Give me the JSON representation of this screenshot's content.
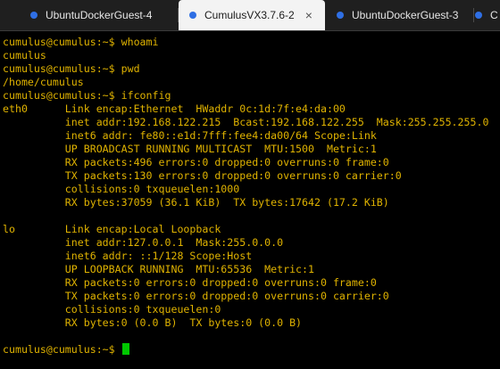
{
  "tabs": [
    {
      "label": "UbuntuDockerGuest-4",
      "active": false,
      "dot_color": "#2f6fe4"
    },
    {
      "label": "CumulusVX3.7.6-2",
      "active": true,
      "dot_color": "#2f6fe4",
      "close": "×"
    },
    {
      "label": "UbuntuDockerGuest-3",
      "active": false,
      "dot_color": "#2f6fe4"
    },
    {
      "label": "C",
      "active": false,
      "dot_color": "#2f6fe4"
    }
  ],
  "terminal": {
    "text_color": "#e0b300",
    "cursor_color": "#00c800",
    "lines": [
      "cumulus@cumulus:~$ whoami",
      "cumulus",
      "cumulus@cumulus:~$ pwd",
      "/home/cumulus",
      "cumulus@cumulus:~$ ifconfig",
      "eth0      Link encap:Ethernet  HWaddr 0c:1d:7f:e4:da:00",
      "          inet addr:192.168.122.215  Bcast:192.168.122.255  Mask:255.255.255.0",
      "          inet6 addr: fe80::e1d:7fff:fee4:da00/64 Scope:Link",
      "          UP BROADCAST RUNNING MULTICAST  MTU:1500  Metric:1",
      "          RX packets:496 errors:0 dropped:0 overruns:0 frame:0",
      "          TX packets:130 errors:0 dropped:0 overruns:0 carrier:0",
      "          collisions:0 txqueuelen:1000",
      "          RX bytes:37059 (36.1 KiB)  TX bytes:17642 (17.2 KiB)",
      "",
      "lo        Link encap:Local Loopback",
      "          inet addr:127.0.0.1  Mask:255.0.0.0",
      "          inet6 addr: ::1/128 Scope:Host",
      "          UP LOOPBACK RUNNING  MTU:65536  Metric:1",
      "          RX packets:0 errors:0 dropped:0 overruns:0 frame:0",
      "          TX packets:0 errors:0 dropped:0 overruns:0 carrier:0",
      "          collisions:0 txqueuelen:0",
      "          RX bytes:0 (0.0 B)  TX bytes:0 (0.0 B)",
      "",
      "cumulus@cumulus:~$ "
    ]
  }
}
